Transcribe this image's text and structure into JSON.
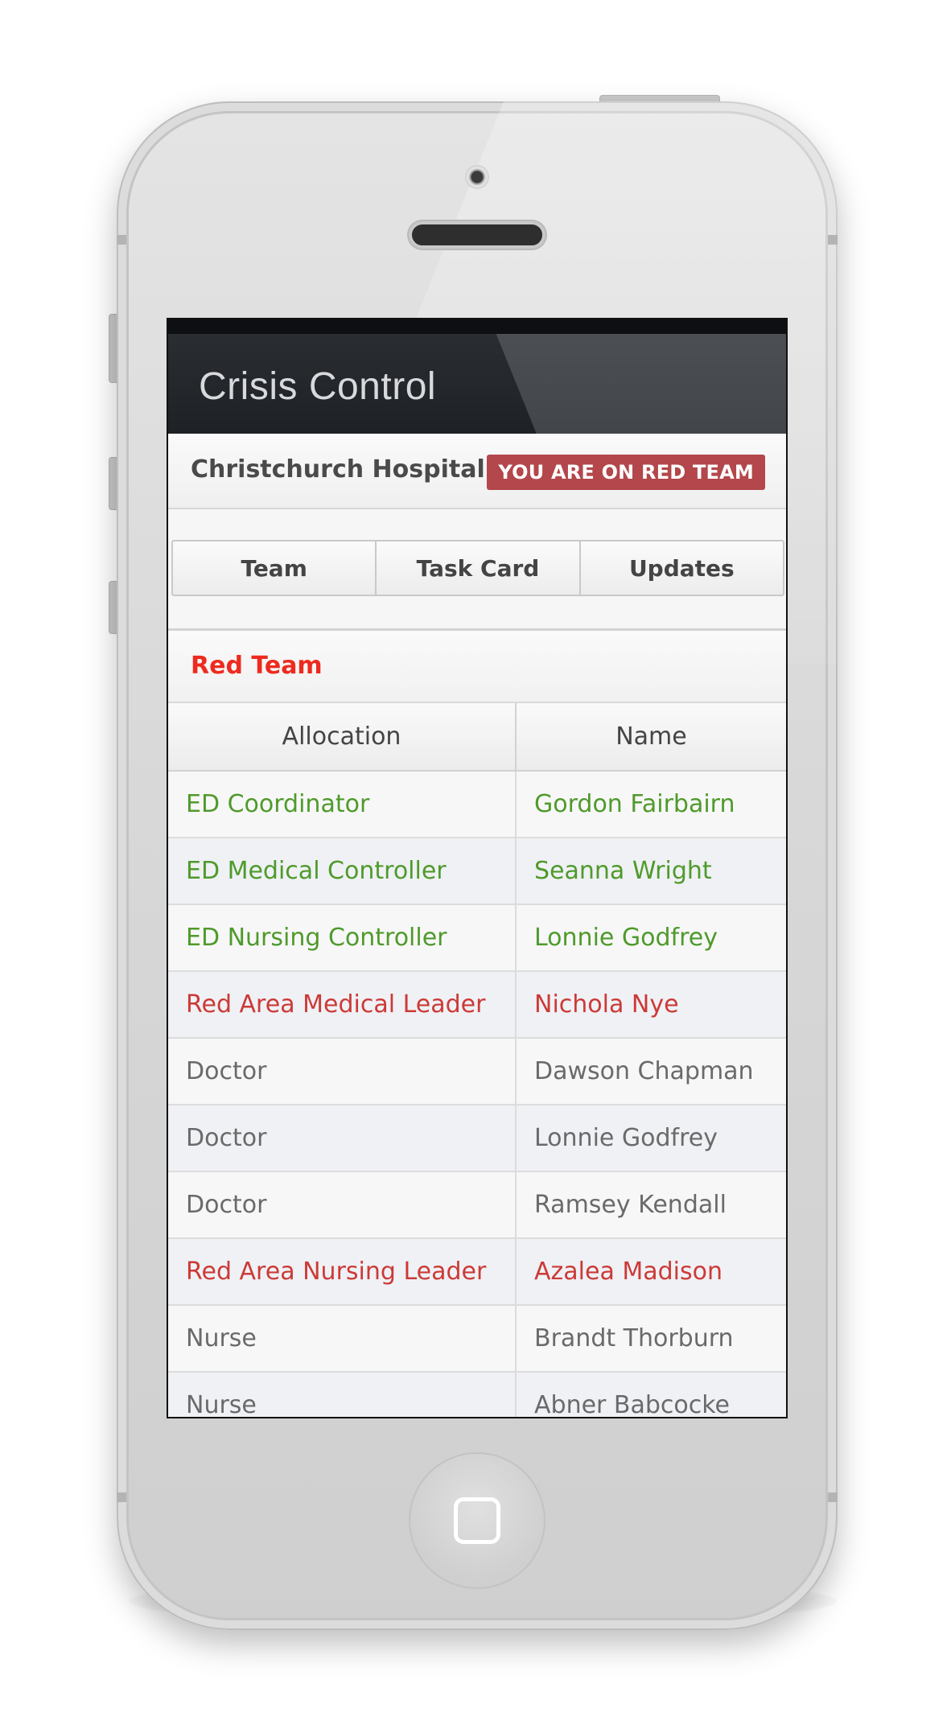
{
  "app": {
    "title": "Crisis Control"
  },
  "hospital": {
    "name": "Christchurch Hospital",
    "team_badge": "YOU ARE ON RED TEAM"
  },
  "tabs": [
    {
      "label": "Team"
    },
    {
      "label": "Task Card"
    },
    {
      "label": "Updates"
    }
  ],
  "team": {
    "heading": "Red Team",
    "columns": {
      "allocation": "Allocation",
      "name": "Name"
    },
    "rows": [
      {
        "allocation": "ED Coordinator",
        "name": "Gordon Fairbairn",
        "status": "green"
      },
      {
        "allocation": "ED Medical Controller",
        "name": "Seanna Wright",
        "status": "green"
      },
      {
        "allocation": "ED Nursing Controller",
        "name": "Lonnie Godfrey",
        "status": "green"
      },
      {
        "allocation": "Red Area Medical Leader",
        "name": "Nichola Nye",
        "status": "red"
      },
      {
        "allocation": "Doctor",
        "name": "Dawson Chapman",
        "status": "grey"
      },
      {
        "allocation": "Doctor",
        "name": "Lonnie Godfrey",
        "status": "grey"
      },
      {
        "allocation": "Doctor",
        "name": "Ramsey Kendall",
        "status": "grey"
      },
      {
        "allocation": "Red Area Nursing Leader",
        "name": "Azalea Madison",
        "status": "red"
      },
      {
        "allocation": "Nurse",
        "name": "Brandt Thorburn",
        "status": "grey"
      },
      {
        "allocation": "Nurse",
        "name": "Abner Babcocke",
        "status": "grey"
      }
    ]
  },
  "colors": {
    "status_green": "#4f9a2b",
    "status_red": "#cc3a36",
    "status_grey": "#6a6a6a",
    "badge": "#b3474b",
    "heading_red": "#ee2a1e"
  }
}
